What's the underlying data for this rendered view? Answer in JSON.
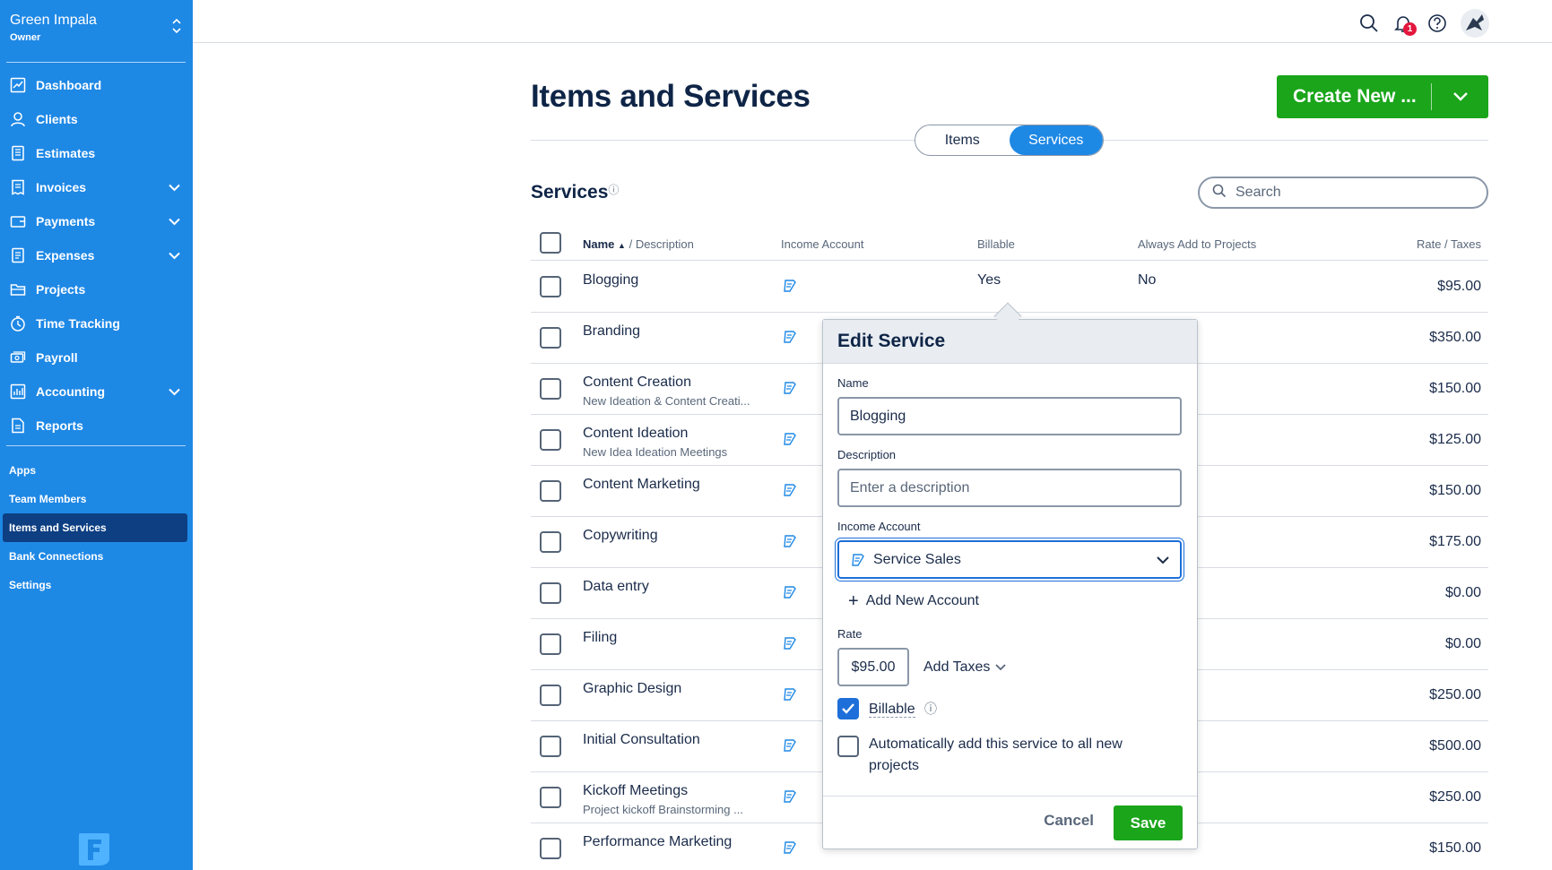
{
  "business": {
    "name": "Green Impala",
    "role": "Owner"
  },
  "nav": [
    {
      "label": "Dashboard",
      "icon": "dashboard-icon",
      "chevron": false
    },
    {
      "label": "Clients",
      "icon": "clients-icon",
      "chevron": false
    },
    {
      "label": "Estimates",
      "icon": "estimates-icon",
      "chevron": false
    },
    {
      "label": "Invoices",
      "icon": "invoices-icon",
      "chevron": true
    },
    {
      "label": "Payments",
      "icon": "payments-icon",
      "chevron": true
    },
    {
      "label": "Expenses",
      "icon": "expenses-icon",
      "chevron": true
    },
    {
      "label": "Projects",
      "icon": "projects-icon",
      "chevron": false
    },
    {
      "label": "Time Tracking",
      "icon": "time-tracking-icon",
      "chevron": false
    },
    {
      "label": "Payroll",
      "icon": "payroll-icon",
      "chevron": false
    },
    {
      "label": "Accounting",
      "icon": "accounting-icon",
      "chevron": true
    },
    {
      "label": "Reports",
      "icon": "reports-icon",
      "chevron": false
    }
  ],
  "subnav": [
    {
      "label": "Apps",
      "active": false
    },
    {
      "label": "Team Members",
      "active": false
    },
    {
      "label": "Items and Services",
      "active": true
    },
    {
      "label": "Bank Connections",
      "active": false
    },
    {
      "label": "Settings",
      "active": false
    }
  ],
  "topbar": {
    "notifications_count": "1"
  },
  "page": {
    "title": "Items and Services",
    "create_label": "Create New ...",
    "toggle_items": "Items",
    "toggle_services": "Services",
    "section_title": "Services",
    "search_placeholder": "Search"
  },
  "table": {
    "headers": {
      "name": "Name",
      "description": "/ Description",
      "income_account": "Income Account",
      "billable": "Billable",
      "always_add": "Always Add to Projects",
      "rate": "Rate / Taxes"
    },
    "rows": [
      {
        "name": "Blogging",
        "description": "",
        "billable": "Yes",
        "always": "No",
        "rate": "$95.00"
      },
      {
        "name": "Branding",
        "description": "",
        "billable": "",
        "always": "",
        "rate": "$350.00"
      },
      {
        "name": "Content Creation",
        "description": "New Ideation & Content Creati...",
        "billable": "",
        "always": "",
        "rate": "$150.00"
      },
      {
        "name": "Content Ideation",
        "description": "New Idea Ideation Meetings",
        "billable": "",
        "always": "",
        "rate": "$125.00"
      },
      {
        "name": "Content Marketing",
        "description": "",
        "billable": "",
        "always": "",
        "rate": "$150.00"
      },
      {
        "name": "Copywriting",
        "description": "",
        "billable": "",
        "always": "",
        "rate": "$175.00"
      },
      {
        "name": "Data entry",
        "description": "",
        "billable": "",
        "always": "",
        "rate": "$0.00"
      },
      {
        "name": "Filing",
        "description": "",
        "billable": "",
        "always": "",
        "rate": "$0.00"
      },
      {
        "name": "Graphic Design",
        "description": "",
        "billable": "",
        "always": "",
        "rate": "$250.00"
      },
      {
        "name": "Initial Consultation",
        "description": "",
        "billable": "",
        "always": "",
        "rate": "$500.00"
      },
      {
        "name": "Kickoff Meetings",
        "description": "Project kickoff Brainstorming ...",
        "billable": "",
        "always": "",
        "rate": "$250.00"
      },
      {
        "name": "Performance Marketing",
        "description": "",
        "billable": "",
        "always": "",
        "rate": "$150.00"
      }
    ]
  },
  "edit": {
    "title": "Edit Service",
    "name_label": "Name",
    "name_value": "Blogging",
    "description_label": "Description",
    "description_placeholder": "Enter a description",
    "income_label": "Income Account",
    "income_value": "Service Sales",
    "add_account": "Add New Account",
    "rate_label": "Rate",
    "rate_value": "$95.00",
    "add_taxes": "Add Taxes",
    "billable_label": "Billable",
    "billable_checked": true,
    "auto_add_label": "Automatically add this service to all new projects",
    "auto_add_checked": false,
    "cancel": "Cancel",
    "save": "Save"
  },
  "colors": {
    "sidebar": "#1e88e5",
    "sidebar_active": "#0d3f82",
    "primary_green": "#1aa51a",
    "accent_blue": "#1e6fd9"
  }
}
